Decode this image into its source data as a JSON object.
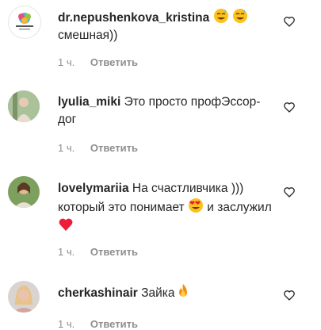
{
  "comments": [
    {
      "user": "dr.nepushenkova_kristina",
      "text": "смешная))",
      "emojis_after_user": [
        "sweat-smile-emoji",
        "sweat-smile-emoji"
      ],
      "time": "1 ч.",
      "reply": "Ответить",
      "avatar": "logo-avatar"
    },
    {
      "user": "lyulia_miki",
      "text": " Это просто профЭссор-дог",
      "time": "1 ч.",
      "reply": "Ответить",
      "avatar": "photo-avatar"
    },
    {
      "user": "lovelymariia",
      "text_part1": " На счастливчика ))) который это понимает ",
      "text_part2": " и заслужил ",
      "emojis": [
        "heart-eyes-emoji",
        "red-heart-emoji"
      ],
      "time": "1 ч.",
      "reply": "Ответить",
      "avatar": "photo-avatar"
    },
    {
      "user": "cherkashinair",
      "text": " Зайка",
      "emojis": [
        "fire-emoji"
      ],
      "time": "1 ч.",
      "reply": "Ответить",
      "avatar": "photo-avatar"
    }
  ],
  "icons": {
    "like": "heart-outline-icon"
  },
  "colors": {
    "text": "#262626",
    "meta": "#8e8e8e",
    "heart": "#ed1d3a"
  }
}
